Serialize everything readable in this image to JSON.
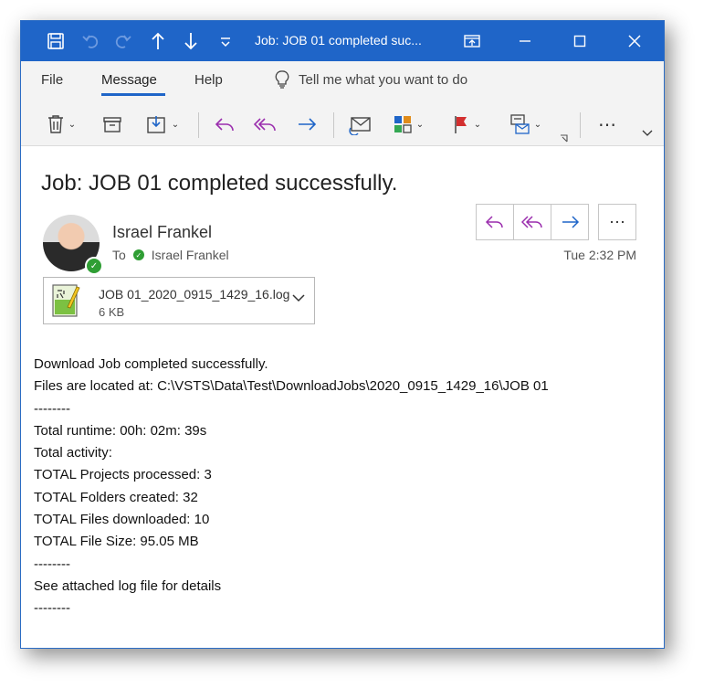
{
  "window": {
    "title": "Job: JOB 01 completed suc...",
    "accent": "#1f65c8"
  },
  "quick_access": {
    "icons": [
      "save-icon",
      "undo-icon",
      "redo-icon",
      "up-icon",
      "down-icon",
      "customize-icon"
    ]
  },
  "window_controls": {
    "icons": [
      "restore-ribbon-icon",
      "minimize-icon",
      "maximize-icon",
      "close-icon"
    ]
  },
  "ribbon": {
    "tabs": [
      {
        "label": "File"
      },
      {
        "label": "Message"
      },
      {
        "label": "Help"
      }
    ],
    "tell_me": "Tell me what you want to do",
    "buttons": [
      "delete-icon",
      "archive-icon",
      "move-icon",
      "reply-icon",
      "reply-all-icon",
      "forward-icon",
      "mark-unread-icon",
      "categorize-icon",
      "flag-icon",
      "quick-steps-icon",
      "more-icon"
    ]
  },
  "message": {
    "subject": "Job: JOB 01 completed successfully.",
    "sender": "Israel Frankel",
    "to_label": "To",
    "recipient": "Israel Frankel",
    "time": "Tue 2:32 PM",
    "attachment": {
      "name": "JOB 01_2020_0915_1429_16.log",
      "size": "6 KB"
    },
    "body": [
      "Download Job completed successfully.",
      "Files are located at: C:\\VSTS\\Data\\Test\\DownloadJobs\\2020_0915_1429_16\\JOB 01",
      "--------",
      "Total runtime: 00h: 02m: 39s",
      "Total activity:",
      "TOTAL Projects processed: 3",
      "TOTAL Folders created: 32",
      "TOTAL Files downloaded: 10",
      "TOTAL File Size: 95.05 MB",
      "--------",
      "See attached log file for details",
      "--------"
    ]
  }
}
